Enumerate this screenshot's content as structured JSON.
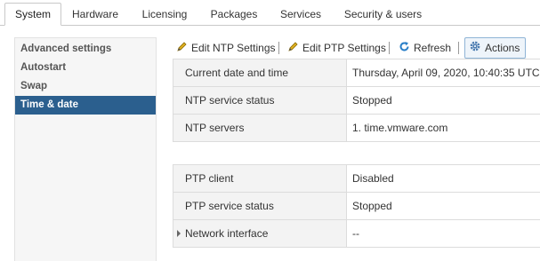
{
  "tabs": [
    "System",
    "Hardware",
    "Licensing",
    "Packages",
    "Services",
    "Security & users"
  ],
  "sidebar": {
    "items": [
      {
        "label": "Advanced settings"
      },
      {
        "label": "Autostart"
      },
      {
        "label": "Swap"
      },
      {
        "label": "Time & date"
      }
    ]
  },
  "toolbar": {
    "edit_ntp": "Edit NTP Settings",
    "edit_ptp": "Edit PTP Settings",
    "refresh": "Refresh",
    "actions": "Actions"
  },
  "ntp_table": [
    {
      "key": "Current date and time",
      "value": "Thursday, April 09, 2020, 10:40:35 UTC"
    },
    {
      "key": "NTP service status",
      "value": "Stopped"
    },
    {
      "key": "NTP servers",
      "value": "1. time.vmware.com"
    }
  ],
  "ptp_table": [
    {
      "key": "PTP client",
      "value": "Disabled"
    },
    {
      "key": "PTP service status",
      "value": "Stopped"
    },
    {
      "key": "Network interface",
      "value": "--"
    }
  ],
  "colors": {
    "selected": "#2b5f8e",
    "accent_refresh": "#2a7fc8",
    "pencil": "#d9a400"
  }
}
